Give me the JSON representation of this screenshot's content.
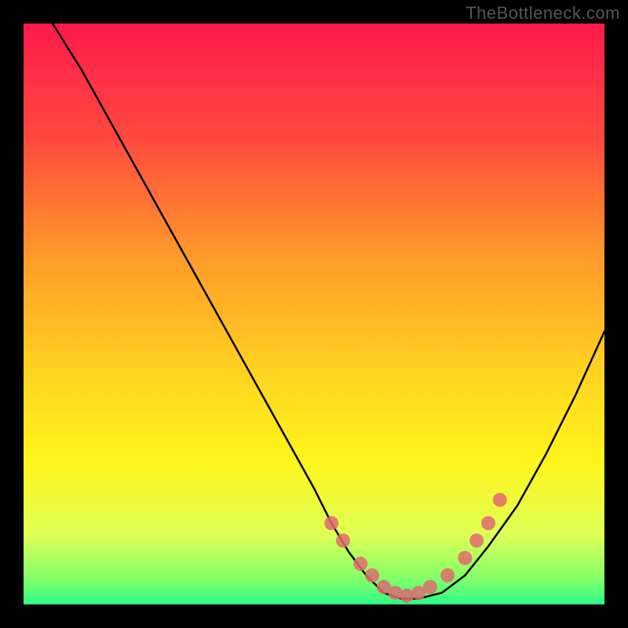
{
  "watermark": "TheBottleneck.com",
  "chart_data": {
    "type": "line",
    "title": "",
    "xlabel": "",
    "ylabel": "",
    "xlim": [
      0,
      100
    ],
    "ylim": [
      0,
      100
    ],
    "gradient_stops": [
      {
        "offset": 0,
        "color": "#ff1a4b"
      },
      {
        "offset": 20,
        "color": "#ff4a3e"
      },
      {
        "offset": 40,
        "color": "#ff9a2a"
      },
      {
        "offset": 60,
        "color": "#ffd321"
      },
      {
        "offset": 75,
        "color": "#fff51a"
      },
      {
        "offset": 88,
        "color": "#dfff55"
      },
      {
        "offset": 96,
        "color": "#7dff6a"
      },
      {
        "offset": 100,
        "color": "#2bfb88"
      }
    ],
    "series": [
      {
        "name": "bottleneck-curve",
        "color": "#000000",
        "x": [
          5,
          10,
          15,
          20,
          25,
          30,
          35,
          40,
          45,
          50,
          53,
          56,
          59,
          62,
          65,
          68,
          72,
          76,
          80,
          85,
          90,
          95,
          100
        ],
        "y": [
          100,
          92,
          83,
          74,
          65,
          56,
          47,
          38,
          29,
          20,
          14,
          9,
          5,
          2,
          1,
          1,
          2,
          5,
          10,
          17,
          26,
          36,
          47
        ]
      }
    ],
    "markers": {
      "name": "highlight-points",
      "color": "#e06a6f",
      "radius": 9,
      "x": [
        53,
        55,
        58,
        60,
        62,
        64,
        66,
        68,
        70,
        73,
        76,
        78,
        80,
        82
      ],
      "y": [
        14,
        11,
        7,
        5,
        3,
        2,
        1.5,
        2,
        3,
        5,
        8,
        11,
        14,
        18
      ]
    }
  }
}
